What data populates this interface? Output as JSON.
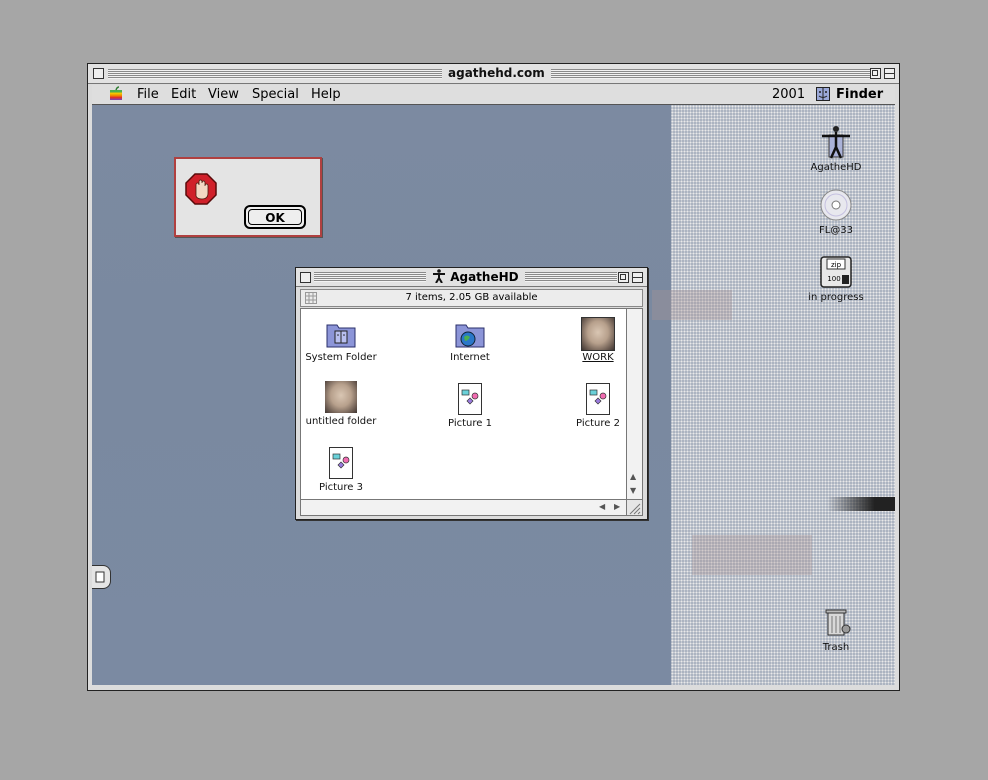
{
  "window": {
    "title": "agathehd.com"
  },
  "menubar": {
    "items": [
      "File",
      "Edit",
      "View",
      "Special",
      "Help"
    ],
    "clock": "2001",
    "active_app": "Finder"
  },
  "alert": {
    "ok_label": "OK"
  },
  "desktop": {
    "icons": [
      {
        "label": "AgatheHD",
        "icon": "hard-drive-figure-icon"
      },
      {
        "label": "FL@33",
        "icon": "cd-icon"
      },
      {
        "label": "in progress",
        "icon": "zip-disk-icon"
      },
      {
        "label": "Trash",
        "icon": "trash-icon"
      }
    ]
  },
  "finder_window": {
    "title": "AgatheHD",
    "info": "7 items, 2.05 GB available",
    "items": [
      {
        "label": "System Folder",
        "icon": "system-folder-icon"
      },
      {
        "label": "Internet",
        "icon": "internet-folder-icon"
      },
      {
        "label": "WORK",
        "icon": "face-folder-icon"
      },
      {
        "label": "untitled folder",
        "icon": "face-folder-icon"
      },
      {
        "label": "Picture 1",
        "icon": "picture-document-icon"
      },
      {
        "label": "Picture 2",
        "icon": "picture-document-icon"
      },
      {
        "label": "Picture 3",
        "icon": "picture-document-icon"
      }
    ]
  },
  "colors": {
    "desktop": "#7b8aa2",
    "stop_red": "#d0202a"
  }
}
